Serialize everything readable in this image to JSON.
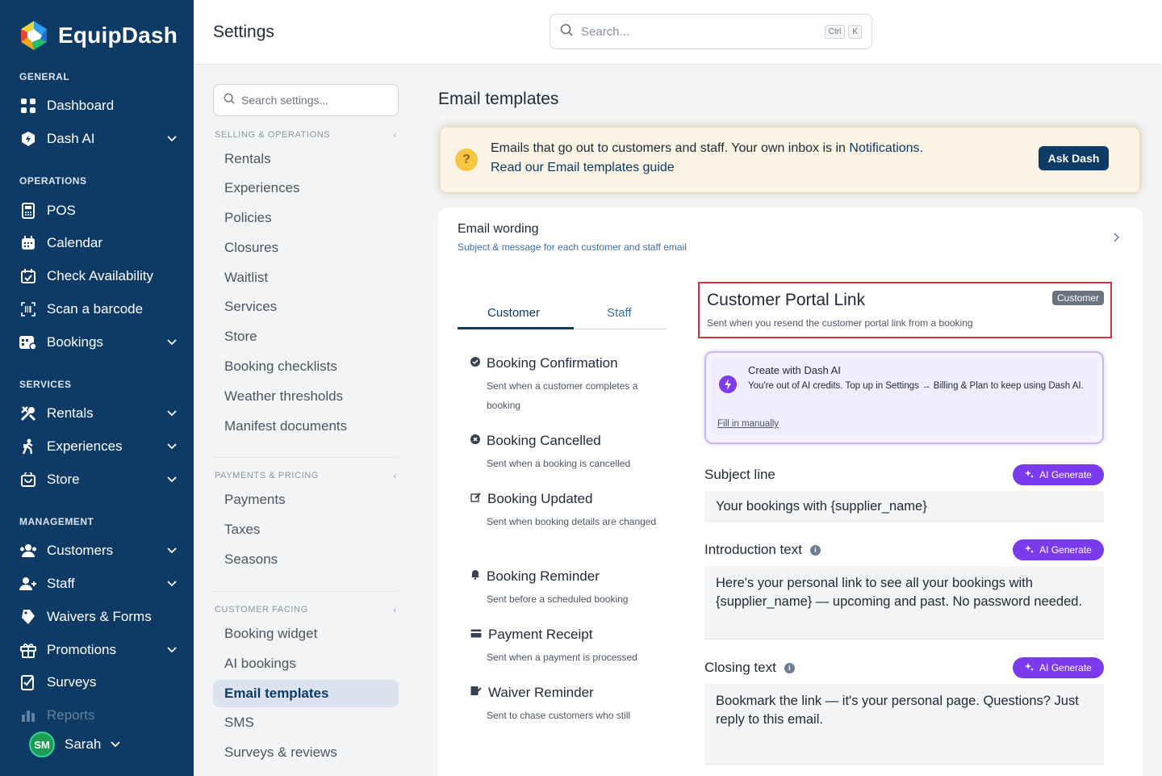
{
  "app": {
    "brand": "EquipDash",
    "page_title": "Settings"
  },
  "colors": {
    "sidebar_bg": "#0e3a66",
    "accent": "#0e3a66",
    "ai_purple": "#7c3aed",
    "highlight_border": "#dc2f3f"
  },
  "sidebar": {
    "sections": {
      "general": "GENERAL",
      "operations": "OPERATIONS",
      "services": "SERVICES",
      "management": "MANAGEMENT"
    },
    "items": {
      "dashboard": "Dashboard",
      "dash_ai": "Dash AI",
      "pos": "POS",
      "calendar": "Calendar",
      "check_availability": "Check Availability",
      "scan_barcode": "Scan a barcode",
      "bookings": "Bookings",
      "rentals": "Rentals",
      "experiences": "Experiences",
      "store": "Store",
      "customers": "Customers",
      "staff": "Staff",
      "waivers": "Waivers & Forms",
      "promotions": "Promotions",
      "surveys": "Surveys",
      "reports": "Reports"
    },
    "user": {
      "initials": "SM",
      "name": "Sarah"
    }
  },
  "topbar": {
    "search_placeholder": "Search...",
    "kbd_ctrl": "Ctrl",
    "kbd_k": "K"
  },
  "settings_menu": {
    "search_placeholder": "Search settings...",
    "sections": {
      "selling": "SELLING & OPERATIONS",
      "payments": "PAYMENTS & PRICING",
      "customer": "CUSTOMER FACING"
    },
    "items": {
      "rentals": "Rentals",
      "experiences": "Experiences",
      "policies": "Policies",
      "closures": "Closures",
      "waitlist": "Waitlist",
      "services": "Services",
      "store": "Store",
      "booking_checklists": "Booking checklists",
      "weather_thresholds": "Weather thresholds",
      "manifest_documents": "Manifest documents",
      "payments": "Payments",
      "taxes": "Taxes",
      "seasons": "Seasons",
      "booking_widget": "Booking widget",
      "ai_bookings": "AI bookings",
      "email_templates": "Email templates",
      "sms": "SMS",
      "surveys_reviews": "Surveys & reviews"
    }
  },
  "main": {
    "title": "Email templates",
    "banner": {
      "line1_prefix": "Emails that go out to customers and staff. Your own inbox is in ",
      "line1_link": "Notifications",
      "line1_suffix": ".",
      "line2": "Read our Email templates guide",
      "button": "Ask Dash",
      "icon": "?"
    },
    "card": {
      "heading": "Email wording",
      "subheading": "Subject & message for each customer and staff email",
      "tabs": {
        "customer": "Customer",
        "staff": "Staff"
      },
      "templates": [
        {
          "title": "Booking Confirmation",
          "desc": "Sent when a customer completes a booking"
        },
        {
          "title": "Booking Cancelled",
          "desc": "Sent when a booking is cancelled"
        },
        {
          "title": "Booking Updated",
          "desc": "Sent when booking details are changed"
        },
        {
          "title": "Booking Reminder",
          "desc": "Sent before a scheduled booking"
        },
        {
          "title": "Payment Receipt",
          "desc": "Sent when a payment is processed"
        },
        {
          "title": "Waiver Reminder",
          "desc": "Sent to chase customers who still"
        }
      ],
      "detail": {
        "title": "Customer Portal Link",
        "subtitle": "Sent when you resend the customer portal link from a booking",
        "badge": "Customer"
      },
      "ai": {
        "title": "Create with Dash AI",
        "message": "You're out of AI credits. Top up in Settings → Billing & Plan to keep using Dash AI.",
        "fill_manually": "Fill in manually"
      },
      "fields": {
        "subject_label": "Subject line",
        "subject_value": "Your bookings with {supplier_name}",
        "intro_label": "Introduction text",
        "intro_value": "Here's your personal link to see all your bookings with {supplier_name} — upcoming and past. No password needed.",
        "closing_label": "Closing text",
        "closing_value": "Bookmark the link — it's your personal page. Questions? Just reply to this email.",
        "ai_generate": "AI Generate"
      }
    }
  }
}
